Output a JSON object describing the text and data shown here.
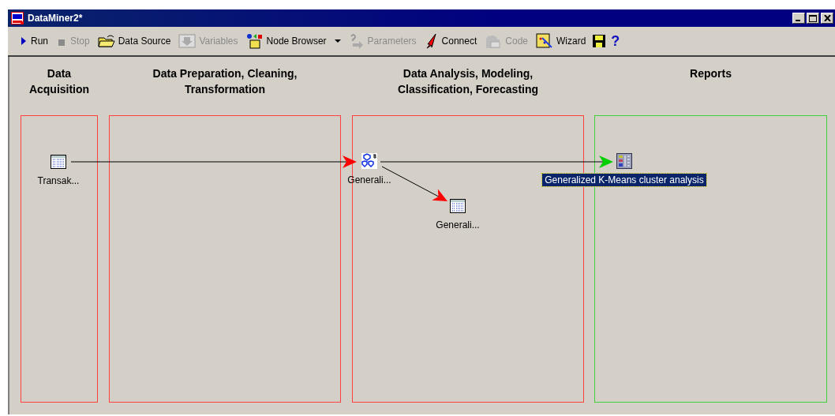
{
  "window": {
    "title": "DataMiner2*"
  },
  "toolbar": [
    {
      "kind": "run",
      "label": "Run",
      "disabled": false
    },
    {
      "kind": "stop",
      "label": "Stop",
      "disabled": true
    },
    {
      "kind": "datasource",
      "label": "Data Source",
      "disabled": false
    },
    {
      "kind": "variables",
      "label": "Variables",
      "disabled": true
    },
    {
      "kind": "nodebrowser",
      "label": "Node Browser",
      "disabled": false,
      "dropdown": true
    },
    {
      "kind": "parameters",
      "label": "Parameters",
      "disabled": true
    },
    {
      "kind": "connect",
      "label": "Connect",
      "disabled": false
    },
    {
      "kind": "code",
      "label": "Code",
      "disabled": true
    },
    {
      "kind": "wizard",
      "label": "Wizard",
      "disabled": false
    },
    {
      "kind": "save"
    },
    {
      "kind": "help",
      "label": "?"
    }
  ],
  "regions": [
    {
      "title": "Data Acquisition",
      "color": "#ff4040"
    },
    {
      "title": "Data Preparation, Cleaning, Transformation",
      "color": "#ff4040"
    },
    {
      "title": "Data Analysis, Modeling, Classification, Forecasting",
      "color": "#ff4040"
    },
    {
      "title": "Reports",
      "color": "#40d040"
    }
  ],
  "nodes": [
    {
      "kind": "table",
      "label": "Transak...",
      "selected": false
    },
    {
      "kind": "cluster",
      "label": "Generali...",
      "selected": false
    },
    {
      "kind": "table",
      "label": "Generali...",
      "selected": false
    },
    {
      "kind": "report",
      "label": "Generalized K-Means cluster analysis",
      "selected": true
    }
  ],
  "connections": [
    {
      "color": "#ff0000"
    },
    {
      "color": "#00d000"
    },
    {
      "color": "#ff0000"
    }
  ]
}
